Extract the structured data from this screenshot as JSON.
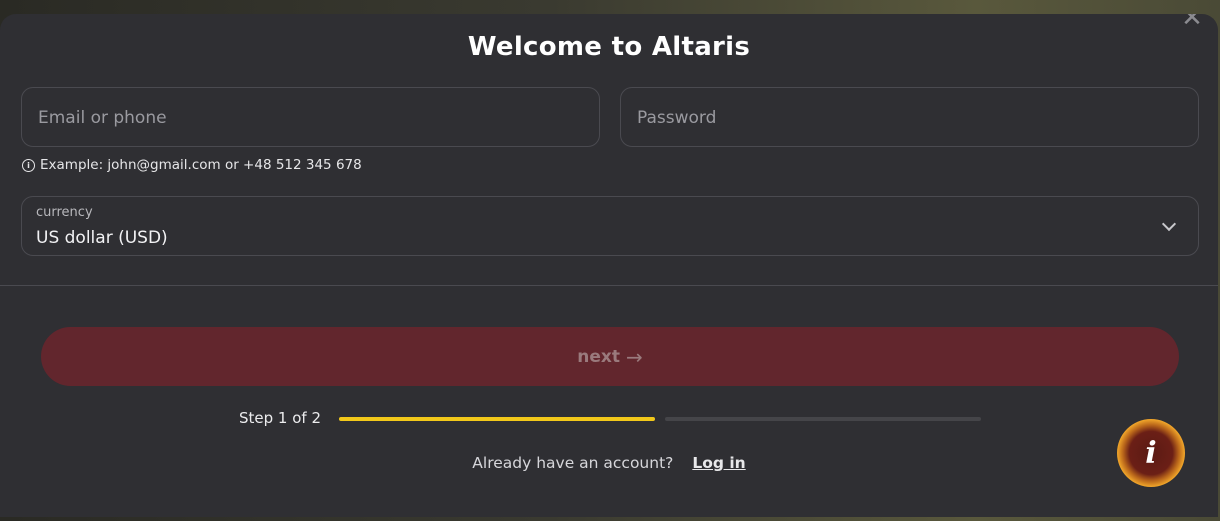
{
  "modal": {
    "title": "Welcome to Altaris",
    "close_icon": "close-icon"
  },
  "form": {
    "email": {
      "placeholder": "Email or phone",
      "value": ""
    },
    "password": {
      "placeholder": "Password",
      "value": ""
    },
    "hint": "Example: john@gmail.com or +48 512 345 678",
    "currency": {
      "label": "currency",
      "value": "US dollar (USD)"
    }
  },
  "actions": {
    "next_label": "next",
    "next_icon": "arrow-right-icon"
  },
  "progress": {
    "step_text": "Step 1 of 2",
    "current_step": 1,
    "total_steps": 2
  },
  "footer": {
    "prompt": "Already have an account?",
    "login_label": "Log in"
  },
  "colors": {
    "accent_yellow": "#f2c81a",
    "next_button_bg": "#62262d",
    "modal_bg": "#2f2f33"
  }
}
